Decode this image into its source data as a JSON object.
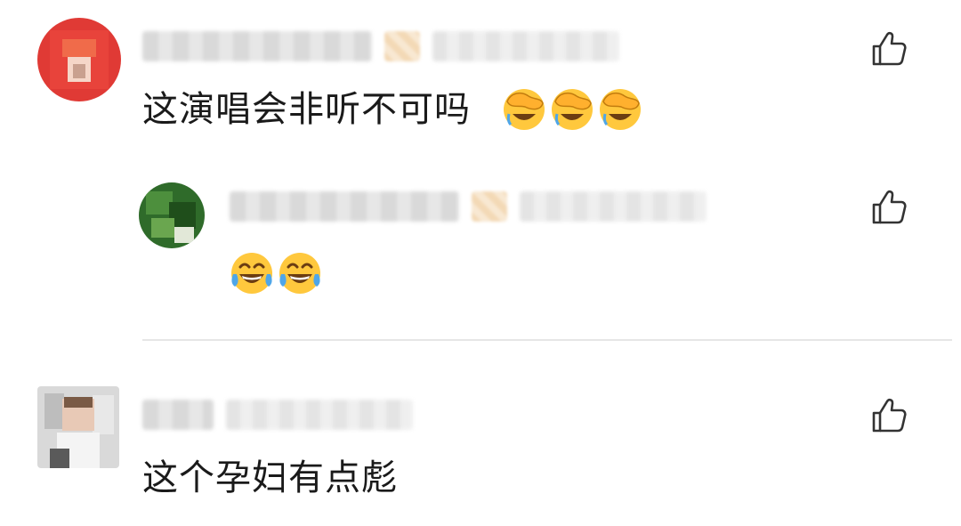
{
  "comments": [
    {
      "text": "这演唱会非听不可吗",
      "emoji_count": 3,
      "emoji_kind": "facepalm-laugh",
      "like_icon": "thumbs-up-icon",
      "replies": [
        {
          "text": "",
          "emoji_count": 2,
          "emoji_kind": "tears-of-joy",
          "like_icon": "thumbs-up-icon"
        }
      ]
    },
    {
      "text": "这个孕妇有点彪",
      "like_icon": "thumbs-up-icon"
    }
  ],
  "colors": {
    "text": "#1a1a1a",
    "divider": "#e6e6e6",
    "like_icon": "#333333",
    "emoji_yellow": "#ffc83d",
    "avatar1": "#e03a35"
  }
}
